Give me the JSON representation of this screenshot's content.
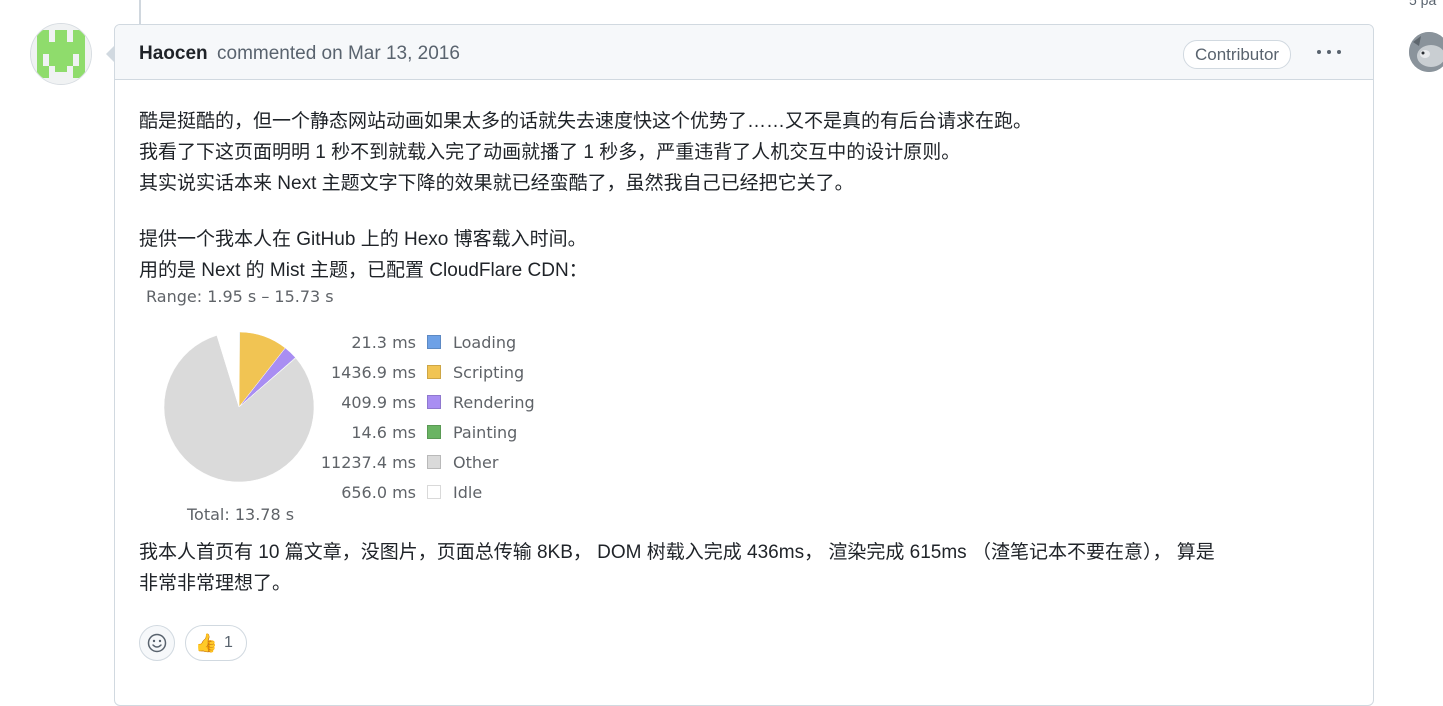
{
  "pagination": {
    "label": "5 pa"
  },
  "comment": {
    "author": "Haocen",
    "meta": "commented on Mar 13, 2016",
    "badge": "Contributor",
    "paragraphs": [
      "酷是挺酷的，但一个静态网站动画如果太多的话就失去速度快这个优势了……又不是真的有后台请求在跑。",
      "我看了下这页面明明 1 秒不到就载入完了动画就播了 1 秒多，严重违背了人机交互中的设计原则。",
      "其实说实话本来 Next 主题文字下降的效果就已经蛮酷了，虽然我自己已经把它关了。",
      "提供一个我本人在 GitHub 上的 Hexo 博客载入时间。",
      "用的是 Next 的 Mist 主题，已配置 CloudFlare CDN：",
      "我本人首页有 10 篇文章，没图片，页面总传输 8KB， DOM 树载入完成 436ms， 渲染完成 615ms （渣笔记本不要在意）， 算是",
      "非常非常理想了。"
    ]
  },
  "icons": {
    "avatar": "identicon-avatar",
    "kebab": "kebab-horizontal-icon",
    "add_reaction": "smiley-icon",
    "thumbs_up": "thumbs-up-icon"
  },
  "colors": {
    "identicon": "#8fdc6c",
    "header_bg": "#f6f8fa",
    "border": "#d1d9e0"
  },
  "chart_data": {
    "type": "pie",
    "range_label": "Range: 1.95 s – 15.73 s",
    "total_label": "Total: 13.78 s",
    "unit": "ms",
    "slices": [
      {
        "name": "Loading",
        "value": 21.3,
        "value_label": "21.3 ms",
        "color": "#6ea1e6"
      },
      {
        "name": "Scripting",
        "value": 1436.9,
        "value_label": "1436.9 ms",
        "color": "#f1c453"
      },
      {
        "name": "Rendering",
        "value": 409.9,
        "value_label": "409.9 ms",
        "color": "#a98ef2"
      },
      {
        "name": "Painting",
        "value": 14.6,
        "value_label": "14.6 ms",
        "color": "#6ab463"
      },
      {
        "name": "Other",
        "value": 11237.4,
        "value_label": "11237.4 ms",
        "color": "#dadada"
      },
      {
        "name": "Idle",
        "value": 656.0,
        "value_label": "656.0 ms",
        "color": "#ffffff"
      }
    ]
  },
  "reactions": {
    "thumbs_up_emoji": "👍",
    "thumbs_up_count": "1"
  }
}
